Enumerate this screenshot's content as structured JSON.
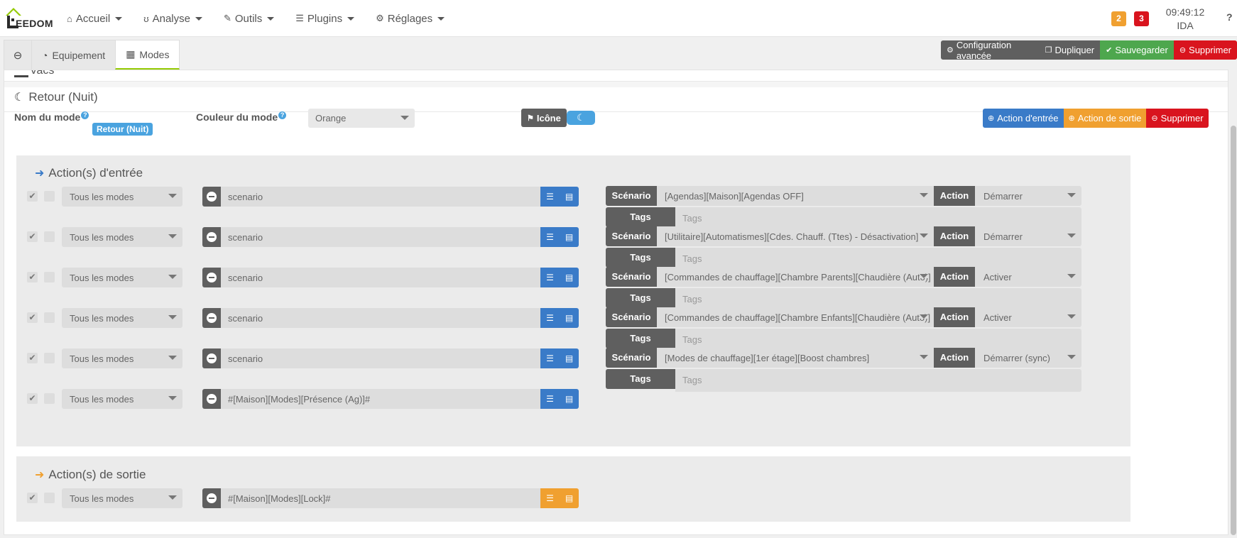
{
  "navbar": {
    "logo_text": "EEDOM",
    "items": [
      {
        "label": "Accueil",
        "icon": "home-icon"
      },
      {
        "label": "Analyse",
        "icon": "stethoscope-icon"
      },
      {
        "label": "Outils",
        "icon": "wrench-icon"
      },
      {
        "label": "Plugins",
        "icon": "tasks-icon"
      },
      {
        "label": "Réglages",
        "icon": "cog-icon"
      }
    ],
    "badge_orange": "2",
    "badge_red": "3",
    "time": "09:49:12",
    "user": "IDA",
    "help": "?"
  },
  "tabs": {
    "equipement": "Equipement",
    "modes": "Modes"
  },
  "top_actions": {
    "config": "Configuration avancée",
    "dupliquer": "Dupliquer",
    "sauvegarder": "Sauvegarder",
    "supprimer": "Supprimer"
  },
  "previous_mode": "Vacs",
  "mode": {
    "title": "Retour (Nuit)",
    "name_label": "Nom du mode",
    "name_value": "Retour (Nuit)",
    "color_label": "Couleur du mode",
    "color_value": "Orange",
    "icon_label": "Icône",
    "actions": {
      "entree": "Action d'entrée",
      "sortie": "Action de sortie",
      "supprimer": "Supprimer"
    }
  },
  "entry_section": {
    "title": "Action(s) d'entrée",
    "rows": [
      {
        "modes": "Tous les modes",
        "cmd": "scenario",
        "scenario": "[Agendas][Maison][Agendas OFF]",
        "action": "Démarrer",
        "tags_placeholder": "Tags"
      },
      {
        "modes": "Tous les modes",
        "cmd": "scenario",
        "scenario": "[Utilitaire][Automatismes][Cdes. Chauff. (Ttes) - Désactivation]",
        "action": "Démarrer",
        "tags_placeholder": "Tags"
      },
      {
        "modes": "Tous les modes",
        "cmd": "scenario",
        "scenario": "[Commandes de chauffage][Chambre Parents][Chaudière (Auto)]",
        "action": "Activer",
        "tags_placeholder": "Tags"
      },
      {
        "modes": "Tous les modes",
        "cmd": "scenario",
        "scenario": "[Commandes de chauffage][Chambre Enfants][Chaudière (Auto)]",
        "action": "Activer",
        "tags_placeholder": "Tags"
      },
      {
        "modes": "Tous les modes",
        "cmd": "scenario",
        "scenario": "[Modes de chauffage][1er étage][Boost chambres]",
        "action": "Démarrer (sync)",
        "tags_placeholder": "Tags"
      },
      {
        "modes": "Tous les modes",
        "cmd": "#[Maison][Modes][Présence (Ag)]#"
      }
    ]
  },
  "exit_section": {
    "title": "Action(s) de sortie",
    "rows": [
      {
        "modes": "Tous les modes",
        "cmd": "#[Maison][Modes][Lock]#"
      }
    ]
  },
  "labels": {
    "scenario": "Scénario",
    "action": "Action",
    "tags": "Tags"
  },
  "colors": {
    "accent_green": "#94ca02",
    "blue": "#3a7bc8",
    "orange": "#f0a030",
    "red": "#d9141e",
    "dark": "#5f5f5f"
  }
}
